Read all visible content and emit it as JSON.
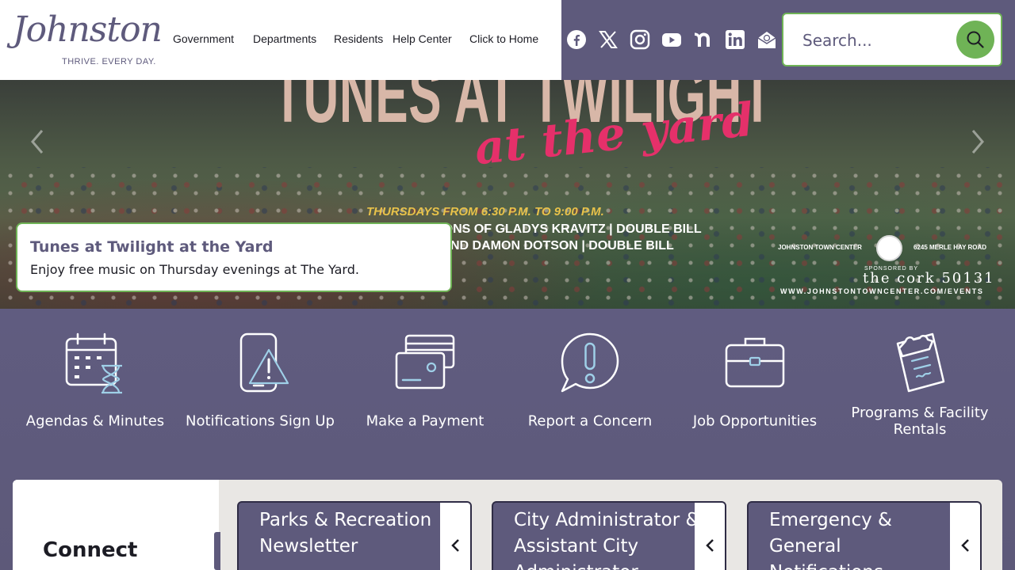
{
  "logo": {
    "script": "Johnston",
    "tagline": "THRIVE. EVERY DAY."
  },
  "nav": {
    "items": [
      {
        "label": "Government"
      },
      {
        "label": "Departments"
      },
      {
        "label": "Residents"
      },
      {
        "label": "Help Center"
      },
      {
        "label": "Click to Home"
      }
    ]
  },
  "social": {
    "icons": [
      "facebook-icon",
      "x-icon",
      "instagram-icon",
      "youtube-icon",
      "nextdoor-icon",
      "linkedin-icon",
      "email-icon"
    ]
  },
  "search": {
    "placeholder": "Search..."
  },
  "hero": {
    "title": "TUNES AT TWILIGHT",
    "script": "at the yard",
    "when": "THURSDAYS FROM 6:30 P.M. TO 9:00 P.M.",
    "line1": "SONS OF GLADYS KRAVITZ | DOUBLE BILL",
    "line2": "ND DAMON DOTSON | DOUBLE BILL",
    "venue": "JOHNSTON TOWN CENTER",
    "address": "6245 MERLE HAY ROAD",
    "sponsor": "SPONSORED BY",
    "cork": "the cork 50131",
    "url": "WWW.JOHNSTONTOWNCENTER.COM/EVENTS",
    "caption_title": "Tunes at Twilight at the Yard",
    "caption_text": "Enjoy free music on Thursday evenings at The Yard."
  },
  "quick_links": [
    {
      "label": "Agendas & Minutes",
      "icon": "calendar-hourglass-icon"
    },
    {
      "label": "Notifications Sign Up",
      "icon": "phone-alert-icon"
    },
    {
      "label": "Make a Payment",
      "icon": "credit-card-icon"
    },
    {
      "label": "Report a Concern",
      "icon": "exclamation-bubble-icon"
    },
    {
      "label": "Job Opportunities",
      "icon": "briefcase-icon"
    },
    {
      "label": "Programs & Facility Rentals",
      "icon": "clipboard-icon"
    }
  ],
  "connect": {
    "title": "Connect"
  },
  "news": [
    {
      "title": "Parks & Recreation Newsletter"
    },
    {
      "title": "City Administrator & Assistant City Administrator"
    },
    {
      "title": "Emergency & General Notifications"
    }
  ],
  "colors": {
    "brand_purple": "#5e5a7c",
    "accent_green": "#6fb356",
    "hero_pink": "#e5306a",
    "hero_gold": "#e8c24a"
  }
}
